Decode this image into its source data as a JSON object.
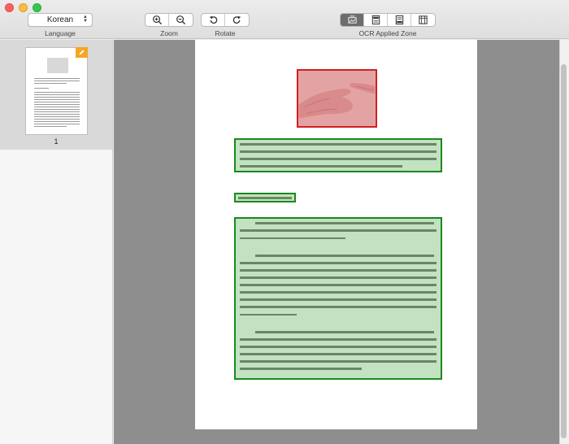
{
  "toolbar": {
    "language": {
      "value": "Korean",
      "label": "Language"
    },
    "zoom": {
      "label": "Zoom",
      "buttons": [
        "zoom-in-icon",
        "zoom-out-icon"
      ]
    },
    "rotate": {
      "label": "Rotate",
      "buttons": [
        "rotate-left-icon",
        "rotate-right-icon"
      ]
    },
    "ocr_zone": {
      "label": "OCR Applied Zone",
      "buttons": [
        "zone-image-icon",
        "zone-header-icon",
        "zone-footer-icon",
        "zone-table-icon"
      ],
      "active_index": 0
    }
  },
  "sidebar": {
    "pages": [
      {
        "number": "1",
        "selected": true,
        "edited": true
      }
    ]
  },
  "colors": {
    "image_zone_border": "#d21f1f",
    "text_zone_border": "#1b8a1b",
    "badge": "#f5a623"
  }
}
